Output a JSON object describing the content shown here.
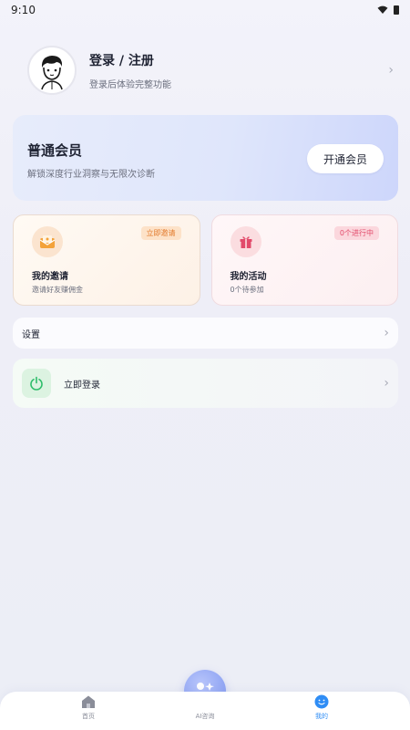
{
  "status_bar": {
    "time": "9:10"
  },
  "profile": {
    "title": "登录 / 注册",
    "subtitle": "登录后体验完整功能"
  },
  "vip": {
    "title": "普通会员",
    "subtitle": "解锁深度行业洞察与无限次诊断",
    "button": "开通会员"
  },
  "tiles": [
    {
      "title": "我的邀请",
      "subtitle": "邀请好友赚佣金",
      "badge": "立即邀请"
    },
    {
      "title": "我的活动",
      "subtitle": "0个待参加",
      "badge": "0个进行中"
    }
  ],
  "rows": {
    "settings": "设置",
    "login": "立即登录"
  },
  "tabbar": {
    "home": "首页",
    "ai": "AI咨询",
    "me": "我的"
  },
  "colors": {
    "accent": "#2f8df5",
    "vip_bg": "#dfe6fb",
    "invite_accent": "#e2792a",
    "activity_accent": "#e24a6a",
    "power_green": "#2ebd6a"
  }
}
